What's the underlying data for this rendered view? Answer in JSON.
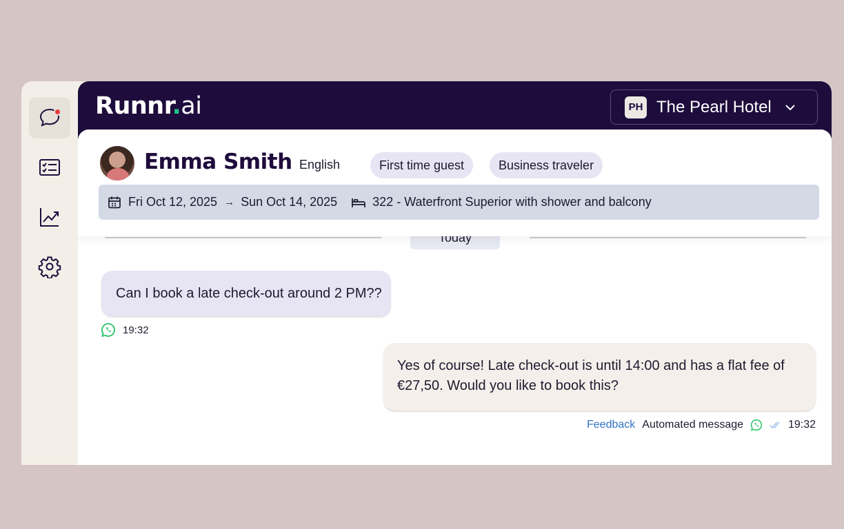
{
  "sidebar": {
    "items": [
      {
        "name": "chat",
        "icon": "chat-bubble-icon",
        "active": true,
        "notification": true
      },
      {
        "name": "tasks",
        "icon": "checklist-icon"
      },
      {
        "name": "analytics",
        "icon": "trend-chart-icon"
      },
      {
        "name": "settings",
        "icon": "gear-icon"
      }
    ]
  },
  "header": {
    "logo_main": "Runnr",
    "logo_dot": ".",
    "logo_suffix": "ai",
    "hotel_initials": "PH",
    "hotel_name": "The Pearl Hotel"
  },
  "guest": {
    "name": "Emma Smith",
    "language": "English",
    "tags": [
      "First time guest",
      "Business traveler"
    ],
    "check_in": "Fri Oct 12, 2025",
    "arrow": "→",
    "check_out": "Sun Oct 14, 2025",
    "room": "322 - Waterfront Superior with shower and balcony"
  },
  "conversation": {
    "date_label": "Today",
    "messages": [
      {
        "direction": "incoming",
        "text": "Can I book a late check-out around 2 PM??",
        "channel_icon": "whatsapp-icon",
        "time": "19:32"
      },
      {
        "direction": "outgoing",
        "text_line1": "Yes of course! Late check-out is until 14:00 and has a flat fee of",
        "text_line2": "€27,50. Would you like to book this?",
        "feedback_label": "Feedback",
        "status_label": "Automated message",
        "channel_icon": "whatsapp-icon",
        "read_icon": "double-check-icon",
        "time": "19:32"
      }
    ]
  },
  "colors": {
    "nav_dark": "#1e0c3c",
    "accent_green": "#20c58b",
    "notification_red": "#e53b3b",
    "whatsapp_green": "#25c167",
    "link_blue": "#2f72c4"
  }
}
